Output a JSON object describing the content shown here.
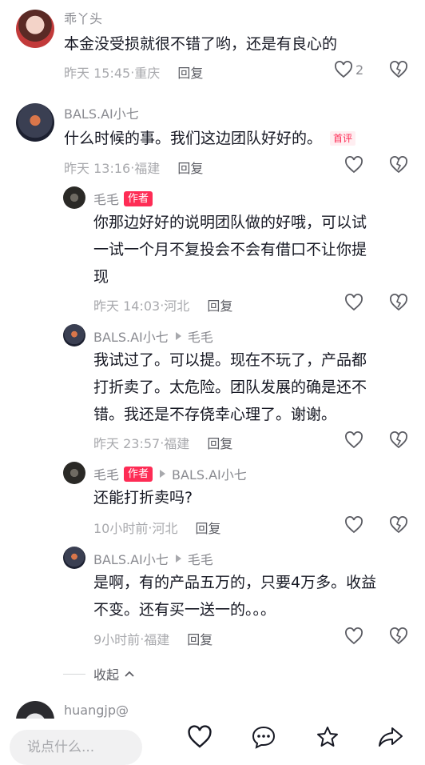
{
  "comments": [
    {
      "username": "乖丫头",
      "text": "本金没受损就很不错了哟，还是有良心的",
      "time": "昨天 15:45",
      "location": "重庆",
      "reply_label": "回复",
      "likes": "2"
    },
    {
      "username": "BALS.AI小七",
      "text": "什么时候的事。我们这边团队好好的。",
      "tag": "首评",
      "time": "昨天 13:16",
      "location": "福建",
      "reply_label": "回复",
      "replies": [
        {
          "username": "毛毛",
          "author_tag": "作者",
          "text_lines": [
            "你那边好好的说明团队做的好哦，可以试",
            "一试一个月不复投会不会有借口不让你提",
            "现"
          ],
          "time": "昨天 14:03",
          "location": "河北",
          "reply_label": "回复"
        },
        {
          "username": "BALS.AI小七",
          "reply_to": "毛毛",
          "text_lines": [
            "我试过了。可以提。现在不玩了，产品都",
            "打折卖了。太危险。团队发展的确是还不",
            "错。我还是不存侥幸心理了。谢谢。"
          ],
          "time": "昨天 23:57",
          "location": "福建",
          "reply_label": "回复"
        },
        {
          "username": "毛毛",
          "author_tag": "作者",
          "reply_to": "BALS.AI小七",
          "text_lines": [
            "还能打折卖吗?"
          ],
          "time": "10小时前",
          "location": "河北",
          "reply_label": "回复"
        },
        {
          "username": "BALS.AI小七",
          "reply_to": "毛毛",
          "text_lines": [
            "是啊，有的产品五万的，只要4万多。收益",
            "不变。还有买一送一的。。。"
          ],
          "time": "9小时前",
          "location": "福建",
          "reply_label": "回复"
        }
      ]
    },
    {
      "username": "huangjp@"
    }
  ],
  "collapse_label": "收起",
  "bottom_bar": {
    "input_placeholder": "说点什么..."
  },
  "colors": {
    "accent": "#fe2c55",
    "meta": "#a8a9ad",
    "text": "#161823"
  }
}
